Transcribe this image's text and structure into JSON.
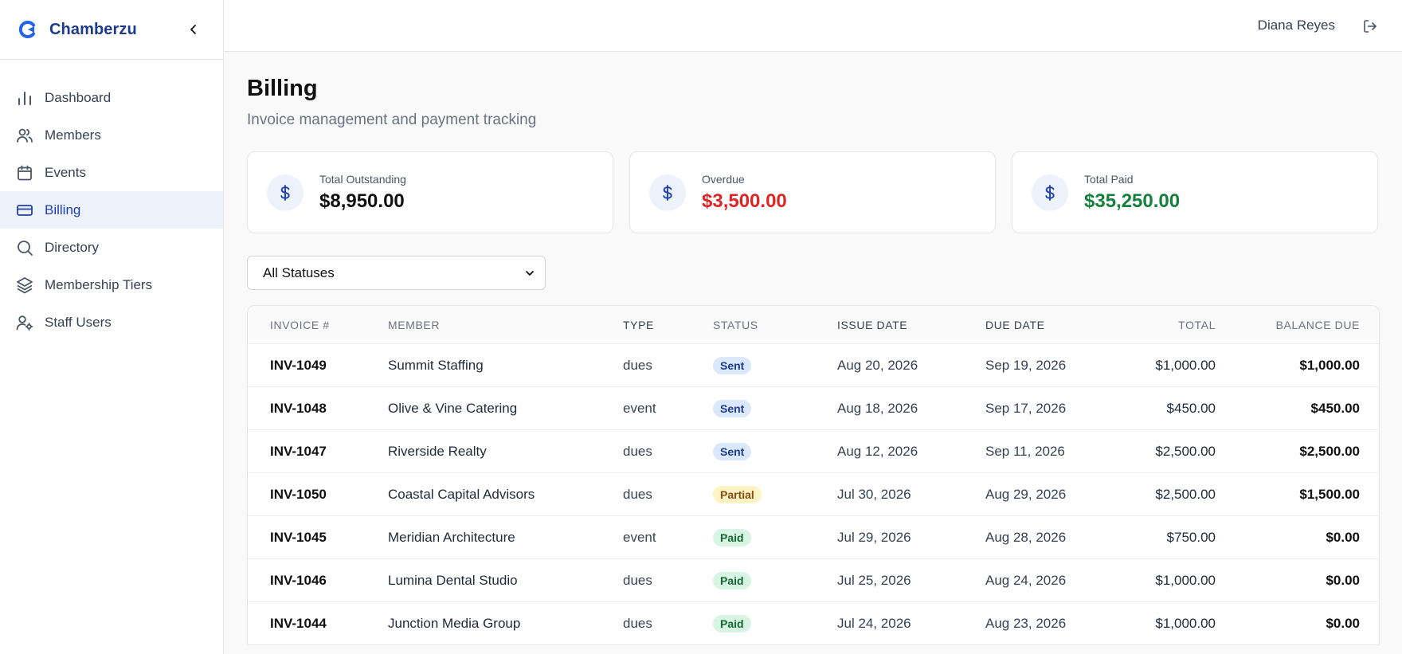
{
  "brand": {
    "name": "Chamberzu"
  },
  "sidebar": {
    "items": [
      {
        "label": "Dashboard",
        "icon": "bar-chart-icon",
        "active": false
      },
      {
        "label": "Members",
        "icon": "users-icon",
        "active": false
      },
      {
        "label": "Events",
        "icon": "calendar-icon",
        "active": false
      },
      {
        "label": "Billing",
        "icon": "credit-card-icon",
        "active": true
      },
      {
        "label": "Directory",
        "icon": "search-icon",
        "active": false
      },
      {
        "label": "Membership Tiers",
        "icon": "layers-icon",
        "active": false
      },
      {
        "label": "Staff Users",
        "icon": "user-cog-icon",
        "active": false
      }
    ]
  },
  "header": {
    "user_name": "Diana Reyes"
  },
  "page": {
    "title": "Billing",
    "subtitle": "Invoice management and payment tracking"
  },
  "stats": [
    {
      "label": "Total Outstanding",
      "value": "$8,950.00",
      "color": "#111111"
    },
    {
      "label": "Overdue",
      "value": "$3,500.00",
      "color": "#dc2626"
    },
    {
      "label": "Total Paid",
      "value": "$35,250.00",
      "color": "#15803d"
    }
  ],
  "filter": {
    "selected": "All Statuses"
  },
  "table": {
    "headers": {
      "invoice": "INVOICE #",
      "member": "MEMBER",
      "type": "TYPE",
      "status": "STATUS",
      "issue_date": "ISSUE DATE",
      "due_date": "DUE DATE",
      "total": "TOTAL",
      "balance": "BALANCE DUE"
    },
    "rows": [
      {
        "invoice": "INV-1049",
        "member": "Summit Staffing",
        "type": "dues",
        "status": "Sent",
        "issue_date": "Aug 20, 2026",
        "due_date": "Sep 19, 2026",
        "total": "$1,000.00",
        "balance": "$1,000.00"
      },
      {
        "invoice": "INV-1048",
        "member": "Olive & Vine Catering",
        "type": "event",
        "status": "Sent",
        "issue_date": "Aug 18, 2026",
        "due_date": "Sep 17, 2026",
        "total": "$450.00",
        "balance": "$450.00"
      },
      {
        "invoice": "INV-1047",
        "member": "Riverside Realty",
        "type": "dues",
        "status": "Sent",
        "issue_date": "Aug 12, 2026",
        "due_date": "Sep 11, 2026",
        "total": "$2,500.00",
        "balance": "$2,500.00"
      },
      {
        "invoice": "INV-1050",
        "member": "Coastal Capital Advisors",
        "type": "dues",
        "status": "Partial",
        "issue_date": "Jul 30, 2026",
        "due_date": "Aug 29, 2026",
        "total": "$2,500.00",
        "balance": "$1,500.00"
      },
      {
        "invoice": "INV-1045",
        "member": "Meridian Architecture",
        "type": "event",
        "status": "Paid",
        "issue_date": "Jul 29, 2026",
        "due_date": "Aug 28, 2026",
        "total": "$750.00",
        "balance": "$0.00"
      },
      {
        "invoice": "INV-1046",
        "member": "Lumina Dental Studio",
        "type": "dues",
        "status": "Paid",
        "issue_date": "Jul 25, 2026",
        "due_date": "Aug 24, 2026",
        "total": "$1,000.00",
        "balance": "$0.00"
      },
      {
        "invoice": "INV-1044",
        "member": "Junction Media Group",
        "type": "dues",
        "status": "Paid",
        "issue_date": "Jul 24, 2026",
        "due_date": "Aug 23, 2026",
        "total": "$1,000.00",
        "balance": "$0.00"
      }
    ]
  },
  "colors": {
    "accent": "#1e40af",
    "status_sent_bg": "#dbe7fb",
    "status_partial_bg": "#fdf3c4",
    "status_paid_bg": "#d7f5e2"
  }
}
